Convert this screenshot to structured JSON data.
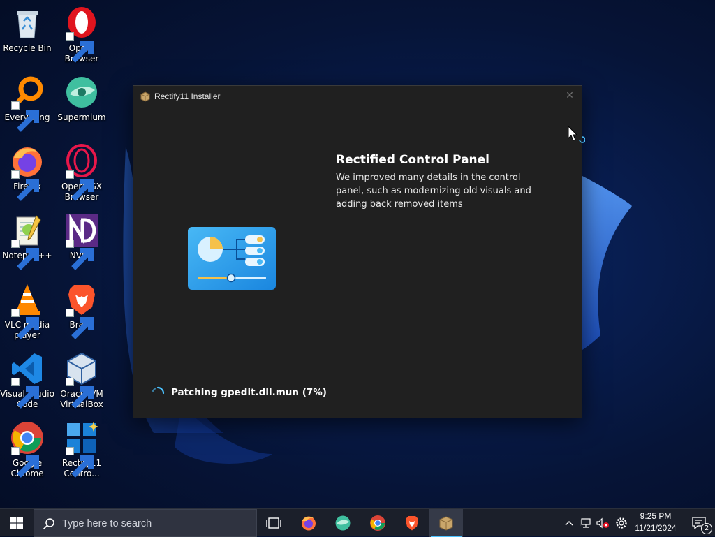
{
  "desktop": {
    "icons": [
      {
        "label": "Recycle Bin",
        "icon": "recycle-bin-icon"
      },
      {
        "label": "Opera\nBrowser",
        "icon": "opera-icon"
      },
      {
        "label": "Everything",
        "icon": "everything-icon"
      },
      {
        "label": "Supermium",
        "icon": "supermium-icon"
      },
      {
        "label": "Firefox",
        "icon": "firefox-icon"
      },
      {
        "label": "Opera GX\nBrowser",
        "icon": "opera-gx-icon"
      },
      {
        "label": "Notepad++",
        "icon": "notepad-plus-plus-icon"
      },
      {
        "label": "NVDA",
        "icon": "nvda-icon"
      },
      {
        "label": "VLC media\nplayer",
        "icon": "vlc-icon"
      },
      {
        "label": "Brave",
        "icon": "brave-icon"
      },
      {
        "label": "Visual Studio\nCode",
        "icon": "vscode-icon"
      },
      {
        "label": "Oracle VM\nVirtualBox",
        "icon": "virtualbox-icon"
      },
      {
        "label": "Google\nChrome",
        "icon": "chrome-icon"
      },
      {
        "label": "Rectify11\nContro...",
        "icon": "rectify11-control-icon"
      }
    ]
  },
  "installer": {
    "window_title": "Rectify11 Installer",
    "close_glyph": "✕",
    "feature_title": "Rectified Control Panel",
    "feature_description": "We improved many details in the control panel, such as modernizing old visuals and adding back removed items",
    "status": "Patching gpedit.dll.mun (7%)",
    "progress_percent": 7,
    "accent_color": "#4cc2ff"
  },
  "taskbar": {
    "search_placeholder": "Type here to search",
    "pinned": [
      "task-view-icon",
      "firefox-icon",
      "supermium-icon",
      "chrome-icon",
      "brave-icon",
      "installer-icon"
    ],
    "active_app": "installer-icon",
    "tray_icons": [
      "chevron-up-icon",
      "network-icon",
      "volume-muted-icon",
      "settings-icon"
    ],
    "time": "9:25 PM",
    "date": "11/21/2024",
    "notification_count": "2"
  }
}
